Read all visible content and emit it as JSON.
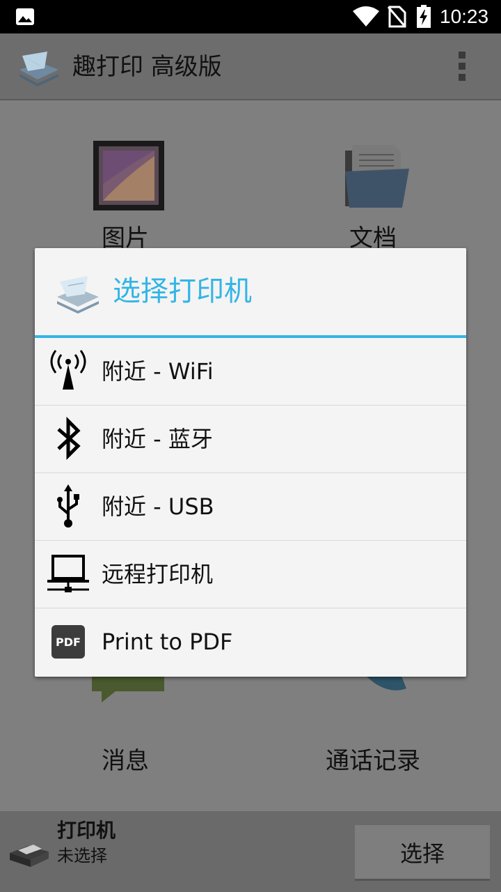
{
  "status_bar": {
    "time": "10:23"
  },
  "app_bar": {
    "title": "趣打印 高级版"
  },
  "grid": {
    "images_label": "图片",
    "documents_label": "文档",
    "messages_label": "消息",
    "call_log_label": "通话记录"
  },
  "dialog": {
    "title": "选择打印机",
    "options": [
      {
        "label": "附近 - WiFi",
        "icon": "wifi-antenna-icon"
      },
      {
        "label": "附近 - 蓝牙",
        "icon": "bluetooth-icon"
      },
      {
        "label": "附近 - USB",
        "icon": "usb-icon"
      },
      {
        "label": "远程打印机",
        "icon": "remote-computer-icon"
      },
      {
        "label": "Print to PDF",
        "icon": "pdf-icon"
      }
    ],
    "pdf_badge": "PDF",
    "accent_color": "#33b5e5"
  },
  "bottom_bar": {
    "printer_title": "打印机",
    "printer_status": "未选择",
    "select_button": "选择"
  }
}
